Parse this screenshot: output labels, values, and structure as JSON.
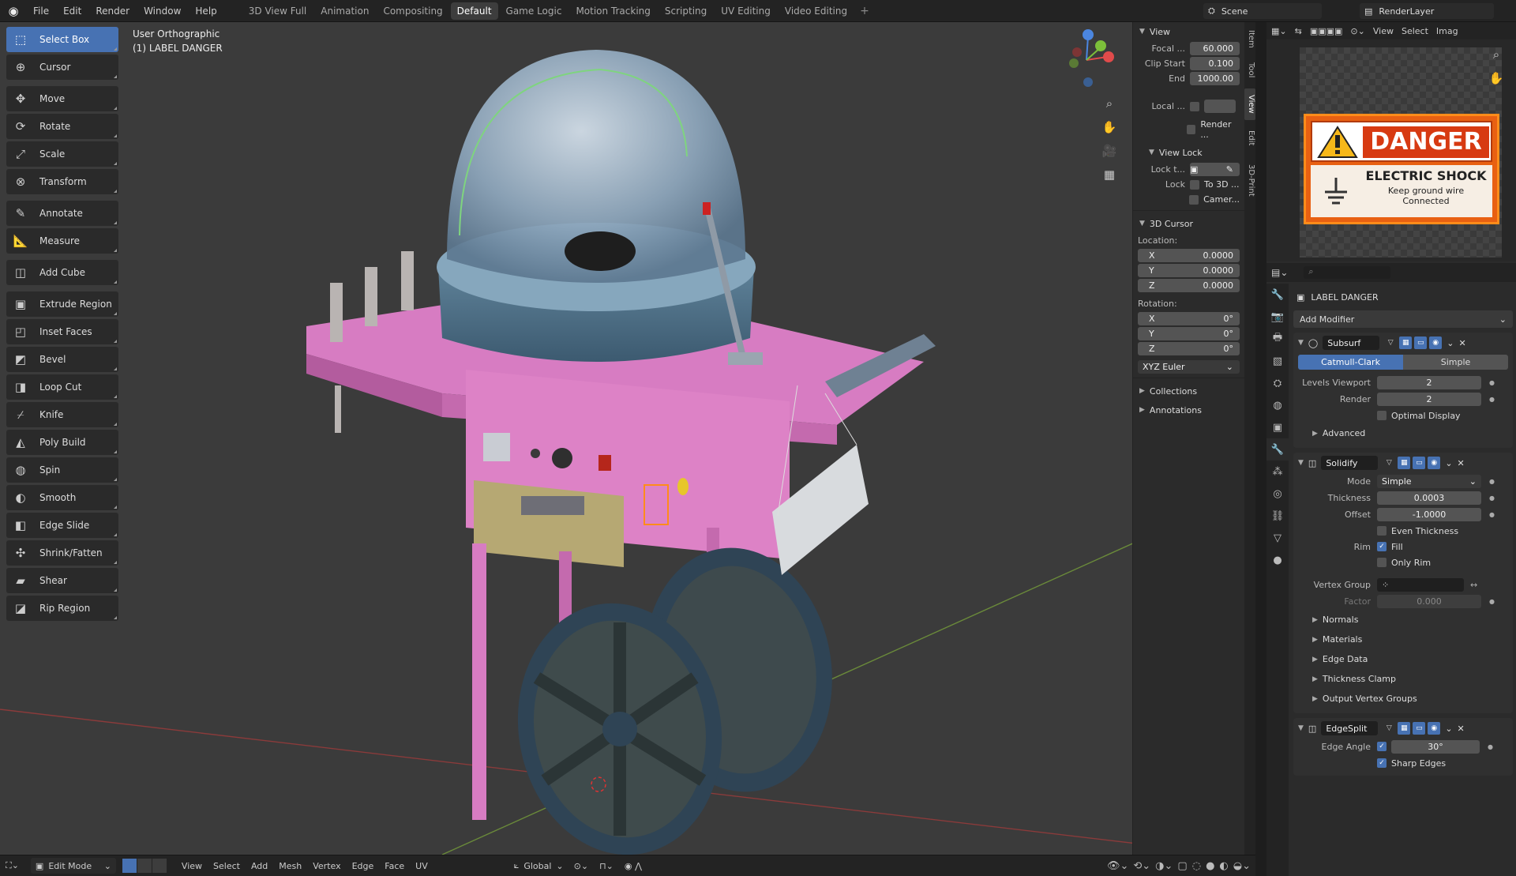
{
  "menus": [
    "File",
    "Edit",
    "Render",
    "Window",
    "Help"
  ],
  "workspaces": [
    {
      "label": "3D View Full"
    },
    {
      "label": "Animation"
    },
    {
      "label": "Compositing"
    },
    {
      "label": "Default",
      "active": true
    },
    {
      "label": "Game Logic"
    },
    {
      "label": "Motion Tracking"
    },
    {
      "label": "Scripting"
    },
    {
      "label": "UV Editing"
    },
    {
      "label": "Video Editing"
    }
  ],
  "scene": "Scene",
  "render_layer": "RenderLayer",
  "viewport": {
    "projection": "User Orthographic",
    "object": "(1) LABEL DANGER"
  },
  "tools": [
    {
      "label": "Select Box",
      "icon": "select-box-icon",
      "glyph": "⬚",
      "selected": true
    },
    {
      "label": "Cursor",
      "icon": "cursor-icon",
      "glyph": "⊕"
    },
    {
      "label": "Move",
      "icon": "move-icon",
      "glyph": "✥",
      "gap": true
    },
    {
      "label": "Rotate",
      "icon": "rotate-icon",
      "glyph": "⟳"
    },
    {
      "label": "Scale",
      "icon": "scale-icon",
      "glyph": "⤢"
    },
    {
      "label": "Transform",
      "icon": "transform-icon",
      "glyph": "⊗"
    },
    {
      "label": "Annotate",
      "icon": "annotate-icon",
      "glyph": "✎",
      "gap": true
    },
    {
      "label": "Measure",
      "icon": "measure-icon",
      "glyph": "📐"
    },
    {
      "label": "Add Cube",
      "icon": "add-cube-icon",
      "glyph": "◫",
      "gap": true
    },
    {
      "label": "Extrude Region",
      "icon": "extrude-region-icon",
      "glyph": "▣",
      "gap": true
    },
    {
      "label": "Inset Faces",
      "icon": "inset-faces-icon",
      "glyph": "◰"
    },
    {
      "label": "Bevel",
      "icon": "bevel-icon",
      "glyph": "◩"
    },
    {
      "label": "Loop Cut",
      "icon": "loop-cut-icon",
      "glyph": "◨"
    },
    {
      "label": "Knife",
      "icon": "knife-icon",
      "glyph": "⌿"
    },
    {
      "label": "Poly Build",
      "icon": "poly-build-icon",
      "glyph": "◭"
    },
    {
      "label": "Spin",
      "icon": "spin-icon",
      "glyph": "◍"
    },
    {
      "label": "Smooth",
      "icon": "smooth-icon",
      "glyph": "◐"
    },
    {
      "label": "Edge Slide",
      "icon": "edge-slide-icon",
      "glyph": "◧"
    },
    {
      "label": "Shrink/Fatten",
      "icon": "shrink-fatten-icon",
      "glyph": "✣"
    },
    {
      "label": "Shear",
      "icon": "shear-icon",
      "glyph": "▰"
    },
    {
      "label": "Rip Region",
      "icon": "rip-region-icon",
      "glyph": "◪"
    }
  ],
  "npanel": {
    "view_header": "View",
    "focal_label": "Focal ...",
    "focal": "60.000",
    "clip_start_label": "Clip Start",
    "clip_start": "0.100",
    "end_label": "End",
    "end": "1000.00",
    "local_label": "Local ...",
    "render_label": "Render ...",
    "view_lock_header": "View Lock",
    "lock_to_label": "Lock t...",
    "lock_label": "Lock",
    "to3d_label": "To 3D ...",
    "camera_label": "Camer...",
    "cursor_header": "3D Cursor",
    "location_label": "Location:",
    "loc": [
      {
        "axis": "X",
        "value": "0.0000"
      },
      {
        "axis": "Y",
        "value": "0.0000"
      },
      {
        "axis": "Z",
        "value": "0.0000"
      }
    ],
    "rotation_label": "Rotation:",
    "rot": [
      {
        "axis": "X",
        "value": "0°"
      },
      {
        "axis": "Y",
        "value": "0°"
      },
      {
        "axis": "Z",
        "value": "0°"
      }
    ],
    "rot_mode": "XYZ Euler",
    "collections": "Collections",
    "annotations": "Annotations",
    "tabs": [
      "Item",
      "Tool",
      "View",
      "Edit",
      "3D-Print"
    ]
  },
  "image_editor": {
    "menus": [
      "View",
      "Select",
      "Imag"
    ],
    "label_title": "DANGER",
    "label_line1": "ELECTRIC SHOCK",
    "label_line2": "Keep ground wire",
    "label_line3": "Connected"
  },
  "properties": {
    "object_name": "LABEL DANGER",
    "add_modifier": "Add Modifier",
    "subsurf": {
      "name": "Subsurf",
      "method_a": "Catmull-Clark",
      "method_b": "Simple",
      "levels_label": "Levels Viewport",
      "levels": "2",
      "render_label": "Render",
      "render": "2",
      "optimal": "Optimal Display",
      "advanced": "Advanced"
    },
    "solidify": {
      "name": "Solidify",
      "mode_label": "Mode",
      "mode": "Simple",
      "thickness_label": "Thickness",
      "thickness": "0.0003",
      "offset_label": "Offset",
      "offset": "-1.0000",
      "even": "Even Thickness",
      "rim_label": "Rim",
      "fill": "Fill",
      "only_rim": "Only Rim",
      "vgroup_label": "Vertex Group",
      "factor_label": "Factor",
      "factor": "0.000",
      "subs": [
        "Normals",
        "Materials",
        "Edge Data",
        "Thickness Clamp",
        "Output Vertex Groups"
      ]
    },
    "edgesplit": {
      "name": "EdgeSplit",
      "angle_label": "Edge Angle",
      "angle": "30°",
      "sharp": "Sharp Edges"
    }
  },
  "bottom": {
    "mode": "Edit Mode",
    "menus": [
      "View",
      "Select",
      "Add",
      "Mesh",
      "Vertex",
      "Edge",
      "Face",
      "UV"
    ],
    "orientation": "Global"
  }
}
